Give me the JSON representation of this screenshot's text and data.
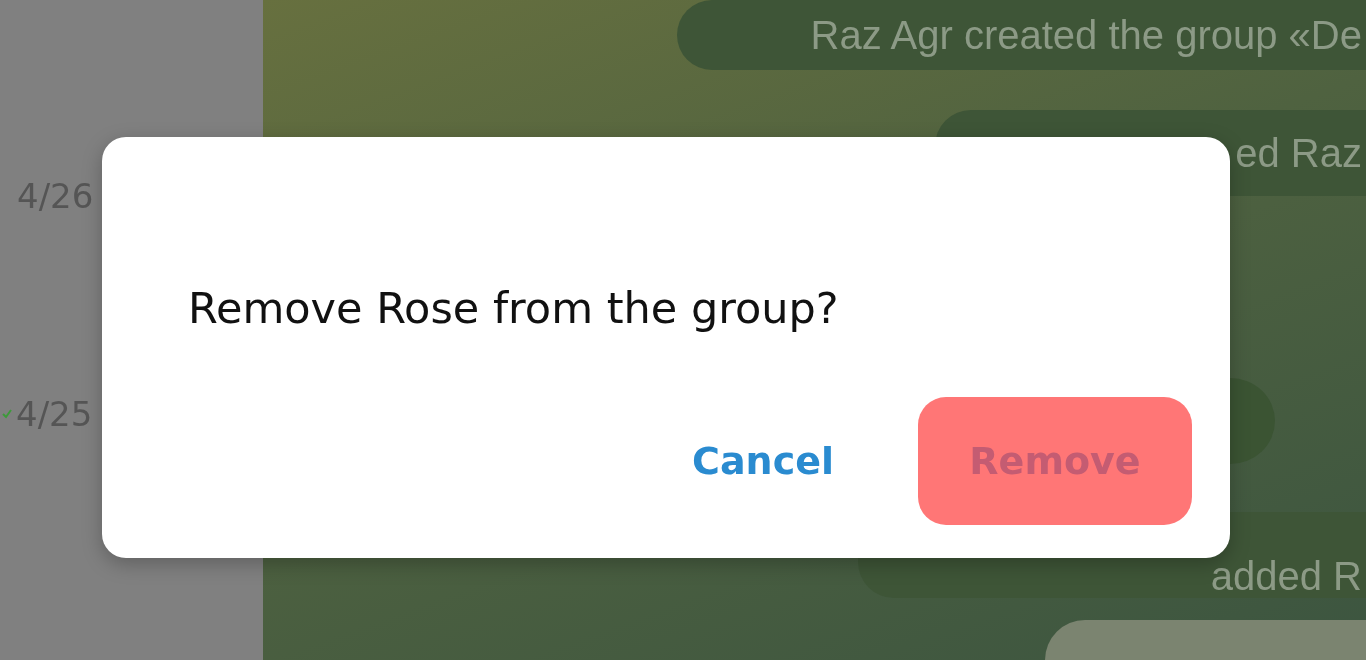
{
  "sidebar": {
    "dates": [
      {
        "text": "4/26",
        "read": false
      },
      {
        "text": "4/25",
        "read": true
      }
    ]
  },
  "chat": {
    "service_messages": [
      "Raz Agr created the group «De",
      "ed Raz",
      "added R"
    ]
  },
  "dialog": {
    "message": "Remove Rose from the group?",
    "buttons": [
      {
        "label": "Cancel",
        "kind": "flat"
      },
      {
        "label": "Remove",
        "kind": "danger"
      }
    ]
  }
}
